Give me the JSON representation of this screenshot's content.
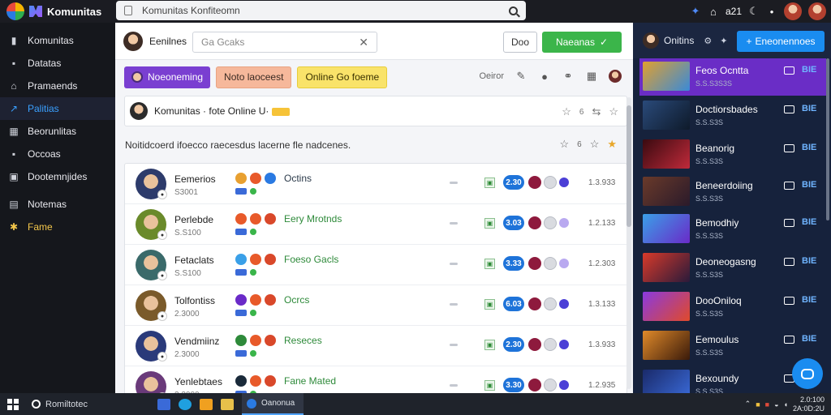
{
  "app": {
    "title": "Komunitas",
    "search_text": "Komunitas Konfiteomn"
  },
  "topbar": {
    "clock": "a21"
  },
  "sidebar": {
    "items": [
      {
        "label": "Komunitas",
        "icon": "book-icon",
        "glyph": "▮"
      },
      {
        "label": "Datatas",
        "icon": "list-icon",
        "glyph": "▪"
      },
      {
        "label": "Pramaends",
        "icon": "home-icon",
        "glyph": "⌂"
      },
      {
        "label": "Palitias",
        "icon": "trend-icon",
        "glyph": "↗",
        "active": true
      },
      {
        "label": "Beorunlitas",
        "icon": "grid-icon",
        "glyph": "▦"
      },
      {
        "label": "Occoas",
        "icon": "square-icon",
        "glyph": "▪"
      },
      {
        "label": "Dootemnjides",
        "icon": "doc-icon",
        "glyph": "▣"
      },
      {
        "label": "Notemas",
        "icon": "folder-icon",
        "glyph": "▤"
      },
      {
        "label": "Fame",
        "icon": "puzzle-icon",
        "glyph": "✱",
        "warn": true
      }
    ]
  },
  "main": {
    "header": {
      "title": "Eenilnes",
      "search_placeholder": "Ga Gcaks",
      "btn_plain": "Doo",
      "btn_green": "Naeanas"
    },
    "filters": {
      "chips": [
        "Noeoneming",
        "Noto laoceest",
        "Online Go foeme"
      ],
      "tools_label": "Oeiror"
    },
    "post": {
      "text": "Komunitas · fote Online U·",
      "count": "6"
    },
    "notice": {
      "text": "Noitidcoerd ifoecco raecesdus lacerne fle nadcenes.",
      "count": "6"
    },
    "rows": [
      {
        "name": "Eemerios",
        "sub": "S3001",
        "game": "Octins",
        "game_color": "#2b3a4a",
        "pill": "2.30",
        "time": "1.3.933",
        "avatar": "#2d3b6b",
        "soft": false
      },
      {
        "name": "Perlebde",
        "sub": "S.S100",
        "game": "Eery Mrotnds",
        "game_color": "#2e8a3a",
        "pill": "3.03",
        "time": "1.2.133",
        "avatar": "#6a8a2a",
        "soft": true
      },
      {
        "name": "Fetaclats",
        "sub": "S.S100",
        "game": "Foeso Gacls",
        "game_color": "#2e8a3a",
        "pill": "3.33",
        "time": "1.2.303",
        "avatar": "#3a6a6a",
        "soft": true
      },
      {
        "name": "Tolfontiss",
        "sub": "2.3000",
        "game": "Ocrcs",
        "game_color": "#2e8a3a",
        "pill": "6.03",
        "time": "1.3.133",
        "avatar": "#7a5a2a",
        "soft": false
      },
      {
        "name": "Vendmiinz",
        "sub": "2.3000",
        "game": "Reseces",
        "game_color": "#2e8a3a",
        "pill": "2.30",
        "time": "1.3.933",
        "avatar": "#2a3a7a",
        "soft": false
      },
      {
        "name": "Yenlebtaes",
        "sub": "2.3000",
        "game": "Fane Mated",
        "game_color": "#2e8a3a",
        "pill": "3.30",
        "time": "1.2.935",
        "avatar": "#6a3a7a",
        "soft": false
      }
    ]
  },
  "right_panel": {
    "title": "Onitins",
    "button": "Eneonennoes",
    "items": [
      {
        "name": "Feos Ocntta",
        "sub": "S.S.S3S3S",
        "tag": "BIE",
        "thumb": "linear-gradient(135deg,#e0a030,#3a8ad8)",
        "active": true
      },
      {
        "name": "Doctiorsbades",
        "sub": "S.S.S3S",
        "tag": "BIE",
        "thumb": "linear-gradient(135deg,#2a4a7a,#0e1a2a)"
      },
      {
        "name": "Beanorig",
        "sub": "S.S.S3S",
        "tag": "BIE",
        "thumb": "linear-gradient(135deg,#3a0a10,#c02a3a)"
      },
      {
        "name": "Beneerdoiing",
        "sub": "S.S.S3S",
        "tag": "BIE",
        "thumb": "linear-gradient(135deg,#6a3a2a,#2a1a2a)"
      },
      {
        "name": "Bemodhiy",
        "sub": "S.S.S3S",
        "tag": "BIE",
        "thumb": "linear-gradient(135deg,#3aa0e8,#6a2ac8)"
      },
      {
        "name": "Deoneogasng",
        "sub": "S.S.S3S",
        "tag": "BIE",
        "thumb": "linear-gradient(135deg,#d83a2a,#2a1a3a)"
      },
      {
        "name": "DooOniloq",
        "sub": "S.S.S3S",
        "tag": "BIE",
        "thumb": "linear-gradient(135deg,#8a3ae0,#e04a2a)"
      },
      {
        "name": "Eemoulus",
        "sub": "S.S.S3S",
        "tag": "BIE",
        "thumb": "linear-gradient(135deg,#e08a2a,#3a1a0a)"
      },
      {
        "name": "Bexoundy",
        "sub": "S.S.S3S",
        "tag": "BIE",
        "thumb": "linear-gradient(135deg,#1a2a6a,#3a6ad8)"
      }
    ]
  },
  "taskbar": {
    "search": "Romiltotec",
    "active_app": "Oanonua",
    "time": "2.0:100",
    "date": "2A:0D:2U"
  }
}
